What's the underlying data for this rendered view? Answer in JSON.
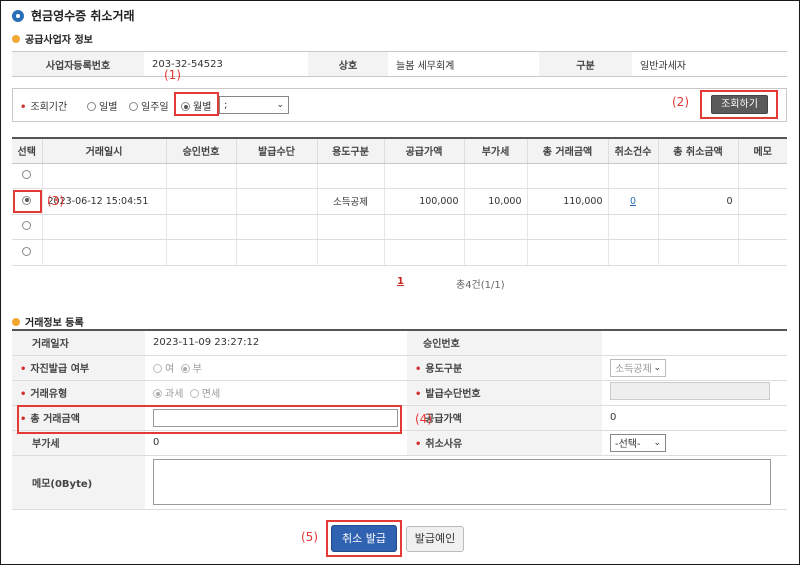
{
  "page_title": "현금영수증 취소거래",
  "supplier": {
    "section_title": "공급사업자 정보",
    "reg_no_label": "사업자등록번호",
    "reg_no_value": "203-32-54523",
    "name_label": "상호",
    "name_value": "늘봄 세무회계",
    "type_label": "구분",
    "type_value": "일반과세자"
  },
  "search": {
    "period_label": "조회기간",
    "opt_daily": "일별",
    "opt_weekly": "일주일",
    "opt_monthly": "월별",
    "month_select_value": ";",
    "search_button": "조회하기"
  },
  "annotations": {
    "a1": "(1)",
    "a2": "(2)",
    "a3": "(3)",
    "a4": "(4)",
    "a5": "(5)"
  },
  "grid": {
    "headers": [
      "선택",
      "거래일시",
      "승인번호",
      "발급수단",
      "용도구분",
      "공급가액",
      "부가세",
      "총 거래금액",
      "취소건수",
      "총 취소금액",
      "메모"
    ],
    "row2": {
      "datetime": "2023-06-12 15:04:51",
      "usage": "소득공제",
      "supply": "100,000",
      "vat": "10,000",
      "total": "110,000",
      "cancel_count": "0",
      "cancel_amount": "0"
    },
    "page_current": "1",
    "page_summary": "총4건(1/1)"
  },
  "form": {
    "section_title": "거래정보 등록",
    "trade_date_label": "거래일자",
    "trade_date_value": "2023-11-09 23:27:12",
    "approval_no_label": "승인번호",
    "self_issue_label": "자진발급 여부",
    "self_issue_yes": "여",
    "self_issue_no": "부",
    "usage_label": "용도구분",
    "usage_value": "소득공제",
    "trade_type_label": "거래유형",
    "trade_type_tax": "과세",
    "trade_type_free": "면세",
    "issue_means_no_label": "발급수단번호",
    "total_amount_label": "총 거래금액",
    "supply_amount_label": "공급가액",
    "supply_amount_value": "0",
    "vat_label": "부가세",
    "vat_value": "0",
    "cancel_reason_label": "취소사유",
    "cancel_reason_value": "-선택-",
    "memo_label": "메모(0Byte)"
  },
  "buttons": {
    "cancel_issue": "취소 발급",
    "issue_confirm": "발급예인"
  }
}
